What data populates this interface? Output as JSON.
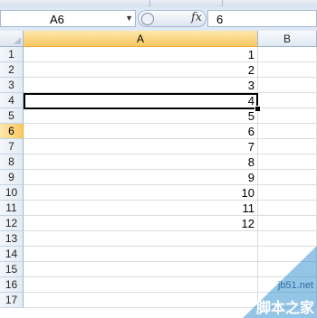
{
  "formula_bar": {
    "name_box": "A6",
    "fx_label": "fx",
    "formula": "6"
  },
  "grid": {
    "columns": [
      "A",
      "B"
    ],
    "active_column": "A",
    "rows": [
      {
        "num": "1",
        "a": "1"
      },
      {
        "num": "2",
        "a": "2"
      },
      {
        "num": "3",
        "a": "3"
      },
      {
        "num": "4",
        "a": "4"
      },
      {
        "num": "5",
        "a": "5"
      },
      {
        "num": "6",
        "a": "6"
      },
      {
        "num": "7",
        "a": "7"
      },
      {
        "num": "8",
        "a": "8"
      },
      {
        "num": "9",
        "a": "9"
      },
      {
        "num": "10",
        "a": "10"
      },
      {
        "num": "11",
        "a": "11"
      },
      {
        "num": "12",
        "a": "12"
      },
      {
        "num": "13",
        "a": ""
      },
      {
        "num": "14",
        "a": ""
      },
      {
        "num": "15",
        "a": ""
      },
      {
        "num": "16",
        "a": ""
      },
      {
        "num": "17",
        "a": ""
      }
    ],
    "active_row": "6"
  },
  "watermark": {
    "url": "jb51.net",
    "site": "脚本之家"
  },
  "colors": {
    "active_header": "#f9c962",
    "selection_border": "#000000"
  }
}
